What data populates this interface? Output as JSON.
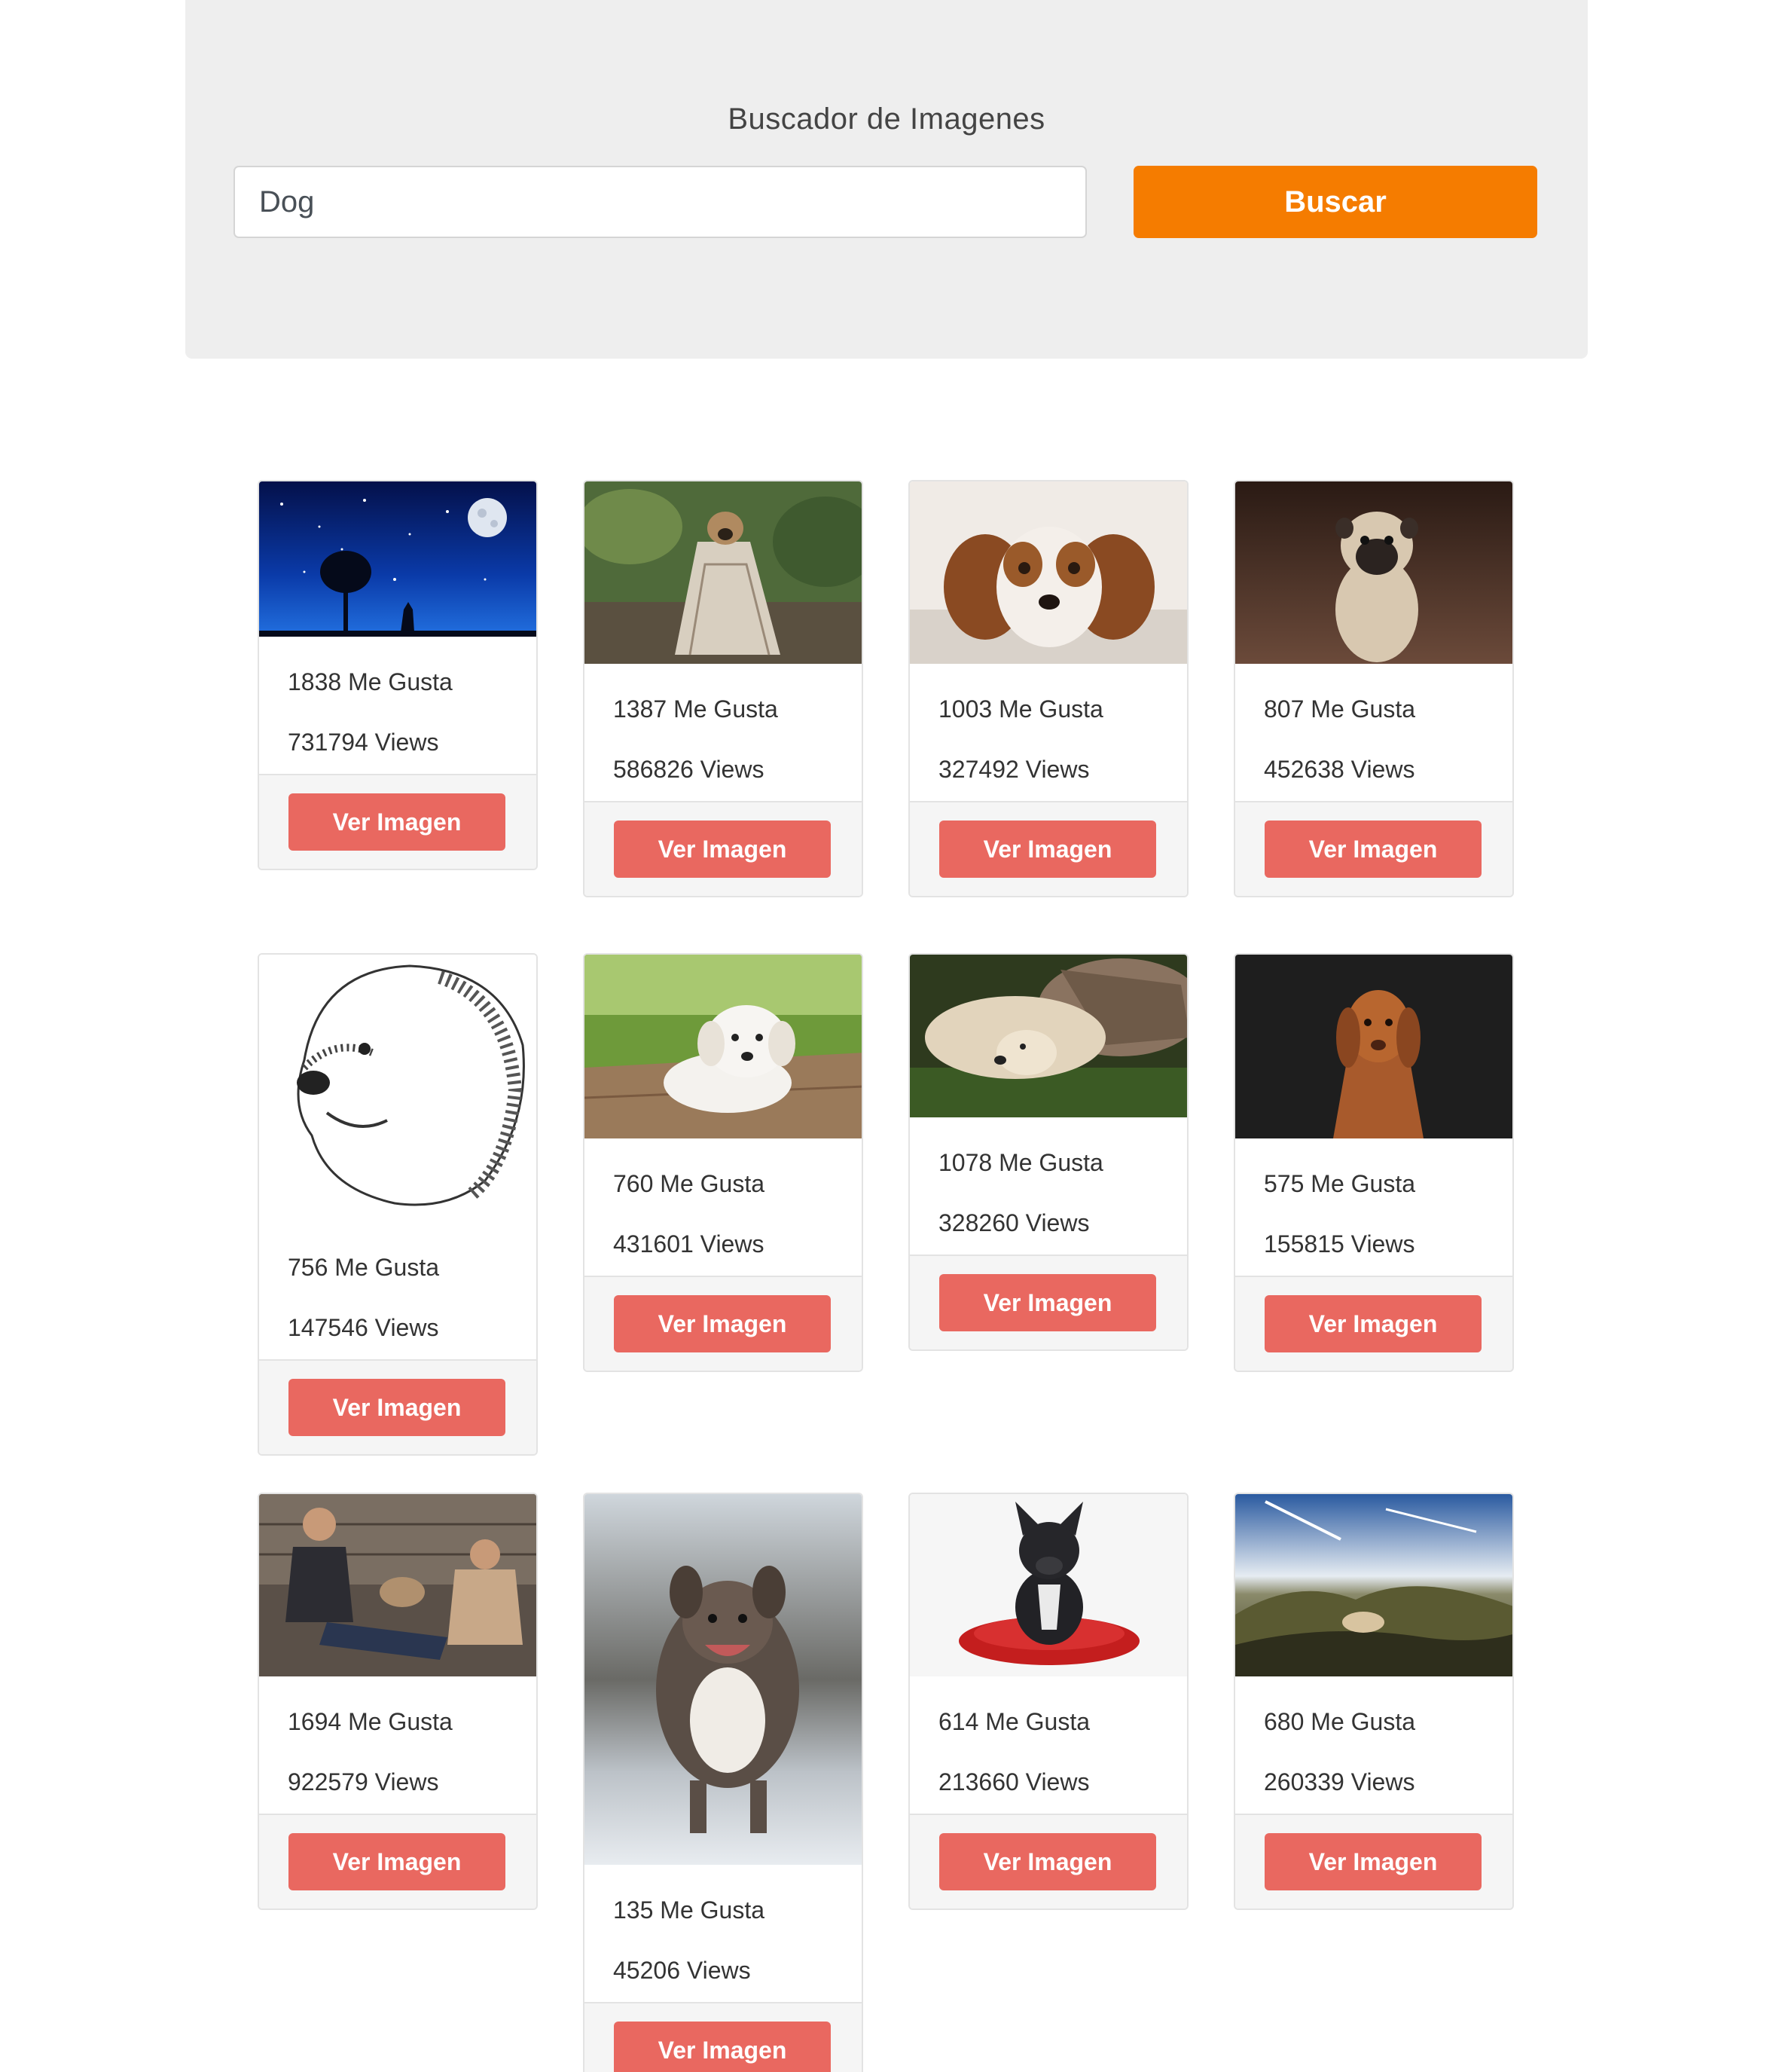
{
  "header": {
    "title": "Buscador de Imagenes",
    "search_value": "Dog",
    "search_button": "Buscar"
  },
  "cards": [
    {
      "likes": "1838 Me Gusta",
      "views": "731794 Views",
      "button": "Ver Imagen",
      "image": "night sky with moon, tree and wolf silhouette"
    },
    {
      "likes": "1387 Me Gusta",
      "views": "586826 Views",
      "button": "Ver Imagen",
      "image": "pug wrapped in plaid blanket in forest"
    },
    {
      "likes": "1003 Me Gusta",
      "views": "327492 Views",
      "button": "Ver Imagen",
      "image": "cavalier spaniel lying on rug"
    },
    {
      "likes": "807 Me Gusta",
      "views": "452638 Views",
      "button": "Ver Imagen",
      "image": "pug puppy on wooden floor"
    },
    {
      "likes": "756 Me Gusta",
      "views": "147546 Views",
      "button": "Ver Imagen",
      "image": "pencil drawing of retriever head"
    },
    {
      "likes": "760 Me Gusta",
      "views": "431601 Views",
      "button": "Ver Imagen",
      "image": "white puppy lying on wooden path"
    },
    {
      "likes": "1078 Me Gusta",
      "views": "328260 Views",
      "button": "Ver Imagen",
      "image": "dog and cat cuddling on grass"
    },
    {
      "likes": "575 Me Gusta",
      "views": "155815 Views",
      "button": "Ver Imagen",
      "image": "brown dog on dark background"
    },
    {
      "likes": "1694 Me Gusta",
      "views": "922579 Views",
      "button": "Ver Imagen",
      "image": "two people sitting with dog"
    },
    {
      "likes": "135 Me Gusta",
      "views": "45206 Views",
      "button": "Ver Imagen",
      "image": "dog running in snow"
    },
    {
      "likes": "614 Me Gusta",
      "views": "213660 Views",
      "button": "Ver Imagen",
      "image": "french bulldog on red cushion"
    },
    {
      "likes": "680 Me Gusta",
      "views": "260339 Views",
      "button": "Ver Imagen",
      "image": "dog on mountain landscape"
    }
  ]
}
